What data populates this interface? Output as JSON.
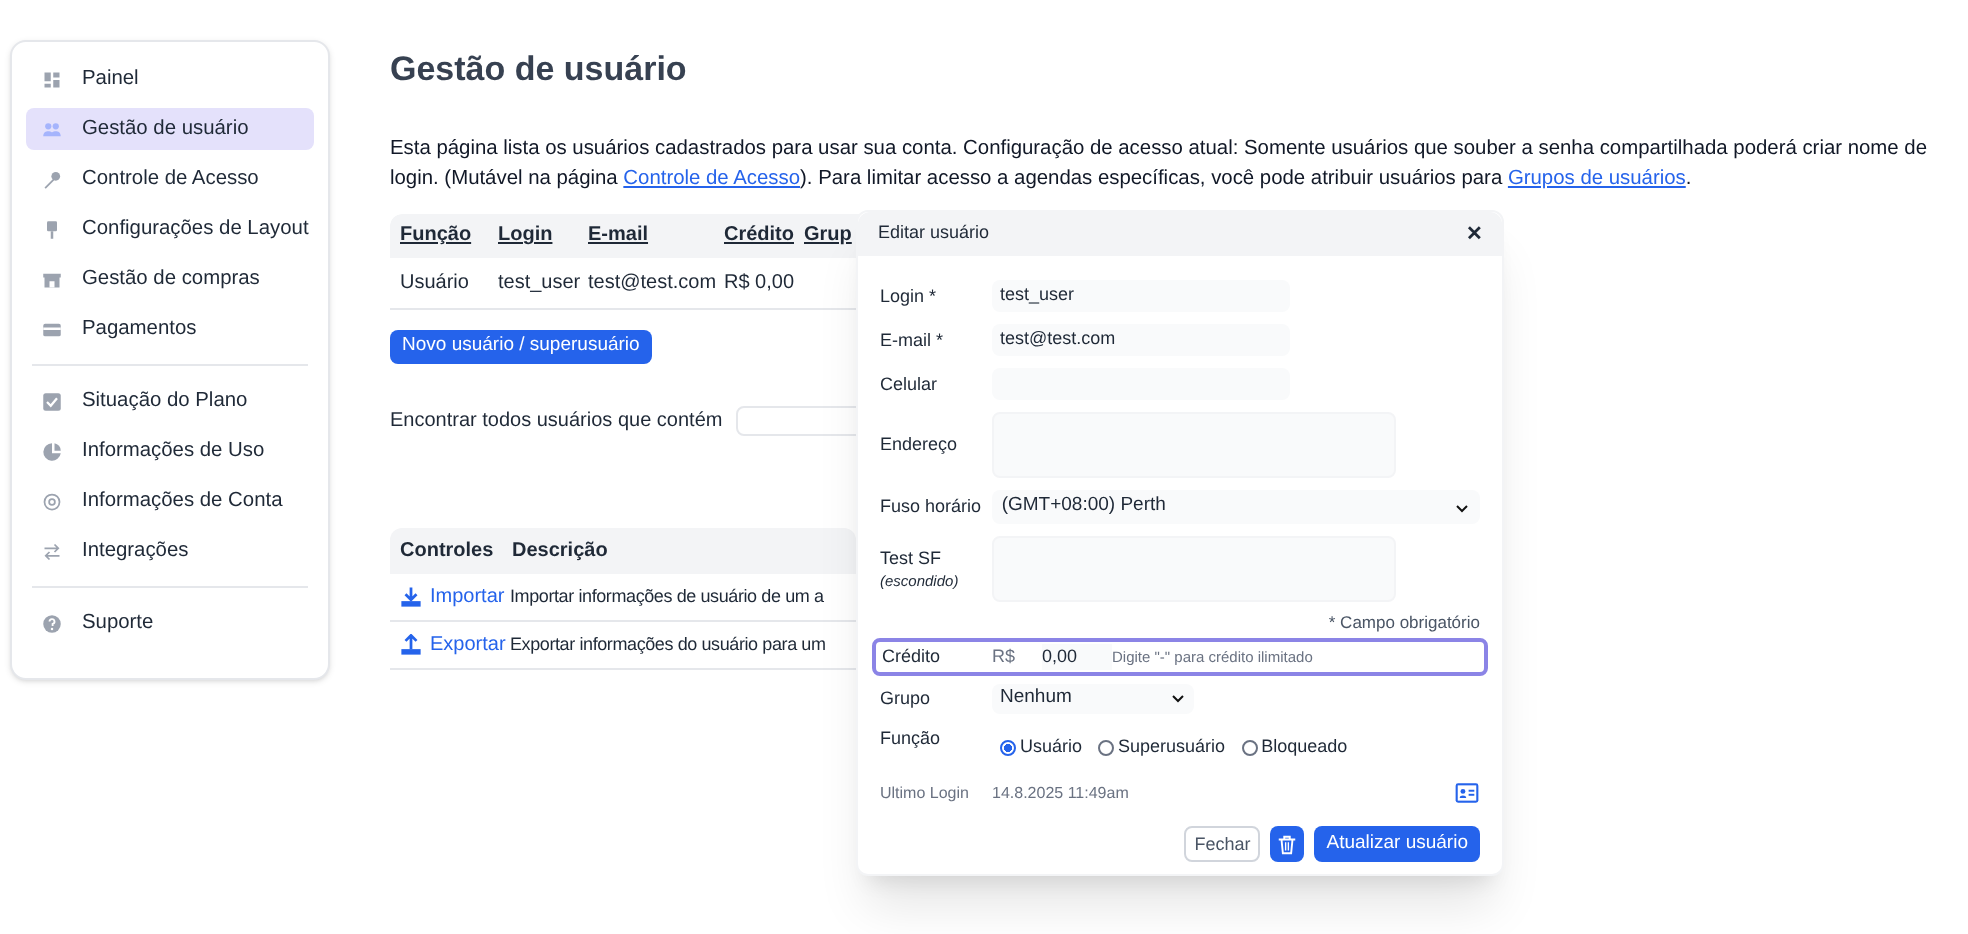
{
  "sidebar": {
    "groups": [
      [
        {
          "label": "Painel",
          "selected": false
        },
        {
          "label": "Gestão de usuário",
          "selected": true
        },
        {
          "label": "Controle de Acesso",
          "selected": false
        },
        {
          "label": "Configurações de Layout",
          "selected": false
        },
        {
          "label": "Gestão de compras",
          "selected": false
        },
        {
          "label": "Pagamentos",
          "selected": false
        }
      ],
      [
        {
          "label": "Situação do Plano",
          "selected": false
        },
        {
          "label": "Informações de Uso",
          "selected": false
        },
        {
          "label": "Informações de Conta",
          "selected": false
        },
        {
          "label": "Integrações",
          "selected": false
        }
      ],
      [
        {
          "label": "Suporte",
          "selected": false
        }
      ]
    ]
  },
  "page": {
    "title": "Gestão de usuário",
    "intro": [
      {
        "kind": "text",
        "text": "Esta página lista os usuários cadastrados para usar sua conta. Configuração de acesso atual: Somente usuários que souber a senha compartilhada poderá criar nome de login. (Mutável na página "
      },
      {
        "kind": "link",
        "text": "Controle de Acesso"
      },
      {
        "kind": "text",
        "text": "). Para limitar acesso a agendas específicas, você pode atribuir usuários para "
      },
      {
        "kind": "link",
        "text": "Grupos de usuários"
      },
      {
        "kind": "text",
        "text": "."
      }
    ],
    "users_table": {
      "columns": [
        "Função",
        "Login",
        "E-mail",
        "Crédito",
        "Grup"
      ],
      "rows": [
        [
          "Usuário",
          "test_user",
          "test@test.com",
          "R$ 0,00",
          ""
        ]
      ]
    },
    "new_user_button": "Novo usuário / superusuário",
    "search_label": "Encontrar todos usuários que contém",
    "controls_table": {
      "columns": [
        "Controles",
        "Descrição"
      ],
      "rows": [
        {
          "kind": "import",
          "action": "Importar",
          "description": "Importar informações de usuário de um a"
        },
        {
          "kind": "export",
          "action": "Exportar",
          "description": "Exportar informações do usuário para um"
        }
      ]
    }
  },
  "dialog": {
    "title": "Editar usuário",
    "close": "✕",
    "fields": [
      {
        "kind": "input",
        "label": "Login *",
        "value": "test_user"
      },
      {
        "kind": "input",
        "label": "E-mail *",
        "value": "test@test.com"
      },
      {
        "kind": "input",
        "label": "Celular"
      },
      {
        "kind": "textarea",
        "label": "Endereço"
      },
      {
        "kind": "select",
        "label": "Fuso horário",
        "value": "(GMT+08:00) Perth"
      },
      {
        "kind": "textarea",
        "label": "Test SF",
        "sublabel": "(escondido)"
      }
    ],
    "required_note": "* Campo obrigatório",
    "credit": {
      "label": "Crédito",
      "prefix": "R$",
      "value": "0,00",
      "hint": "Digite \"-\" para crédito ilimitado"
    },
    "group": {
      "label": "Grupo",
      "value": "Nenhum"
    },
    "role": {
      "label": "Função",
      "options": [
        {
          "label": "Usuário",
          "selected": true
        },
        {
          "label": "Superusuário",
          "selected": false
        },
        {
          "label": "Bloqueado",
          "selected": false
        }
      ]
    },
    "last_login": {
      "label": "Ultimo Login",
      "value": "14.8.2025 11:49am"
    },
    "buttons": {
      "close": "Fechar",
      "update": "Atualizar usuário"
    }
  }
}
